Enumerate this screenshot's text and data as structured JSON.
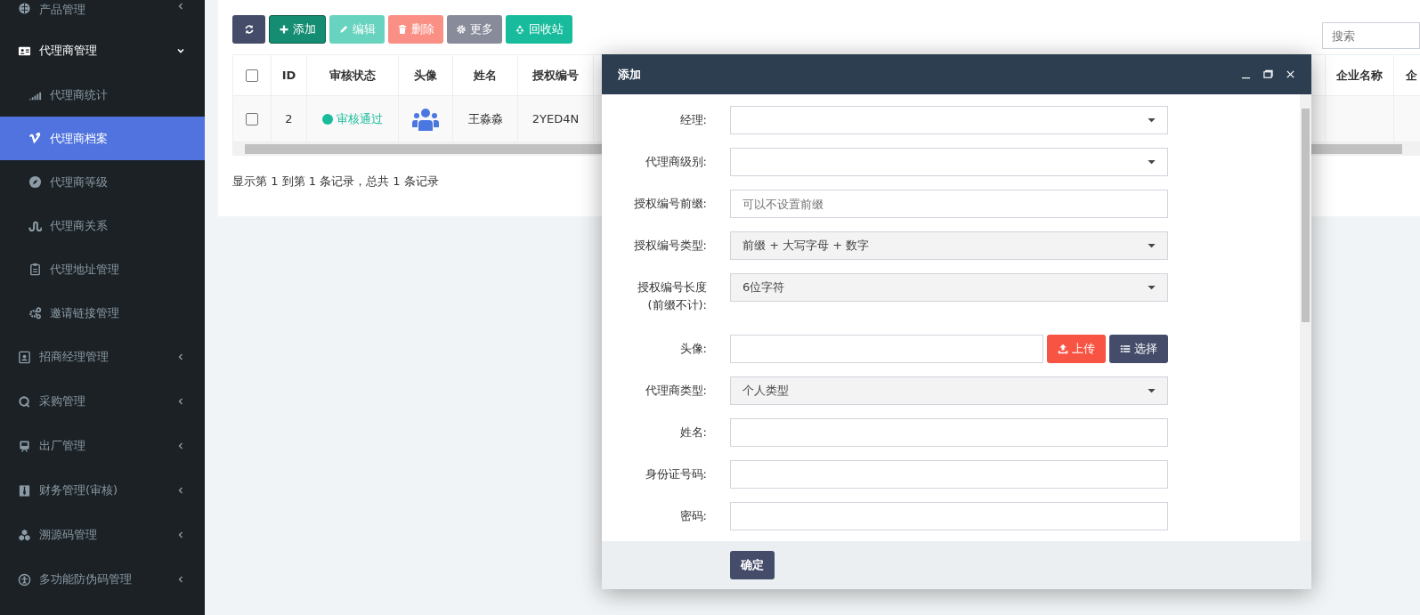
{
  "sidebar": {
    "items": [
      {
        "label": "产品管理",
        "selected": false,
        "expanded": false
      },
      {
        "label": "代理商管理",
        "selected": false,
        "expanded": true,
        "children": [
          {
            "label": "代理商统计",
            "selected": false
          },
          {
            "label": "代理商档案",
            "selected": true
          },
          {
            "label": "代理商等级",
            "selected": false
          },
          {
            "label": "代理商关系",
            "selected": false
          },
          {
            "label": "代理地址管理",
            "selected": false
          },
          {
            "label": "邀请链接管理",
            "selected": false
          }
        ]
      },
      {
        "label": "招商经理管理",
        "selected": false,
        "expanded": false
      },
      {
        "label": "采购管理",
        "selected": false,
        "expanded": false
      },
      {
        "label": "出厂管理",
        "selected": false,
        "expanded": false
      },
      {
        "label": "财务管理(审核)",
        "selected": false,
        "expanded": false
      },
      {
        "label": "溯源码管理",
        "selected": false,
        "expanded": false
      },
      {
        "label": "多功能防伪码管理",
        "selected": false,
        "expanded": false
      }
    ]
  },
  "toolbar": {
    "buttons": [
      {
        "kind": "refresh",
        "disabled": false
      },
      {
        "kind": "add",
        "label": "添加",
        "disabled": false
      },
      {
        "kind": "edit",
        "label": "编辑",
        "disabled": true
      },
      {
        "kind": "delete",
        "label": "删除",
        "disabled": true
      },
      {
        "kind": "more",
        "label": "更多",
        "disabled": false
      },
      {
        "kind": "recycle",
        "label": "回收站",
        "disabled": false
      }
    ],
    "search": {
      "placeholder": "搜索"
    }
  },
  "table": {
    "select_all": {
      "checked": false
    },
    "columns": [
      "ID",
      "审核状态",
      "头像",
      "姓名",
      "授权编号",
      "企业名称",
      "企"
    ],
    "rows": [
      {
        "checked": false,
        "id": "2",
        "status": {
          "label": "审核通过",
          "color": "#18bc9c"
        },
        "name": "王淼淼",
        "code": "2YED4N"
      }
    ]
  },
  "pagination": {
    "summary": "显示第 1 到第 1 条记录，总共 1 条记录"
  },
  "dialog": {
    "title": "添加",
    "fields": [
      {
        "kind": "select",
        "label": "经理:",
        "disabled": false
      },
      {
        "kind": "select",
        "label": "代理商级别:",
        "disabled": false
      },
      {
        "kind": "text",
        "label": "授权编号前缀:",
        "placeholder": "可以不设置前缀"
      },
      {
        "kind": "select",
        "label": "授权编号类型:",
        "value": "前缀 + 大写字母 + 数字",
        "disabled": true
      },
      {
        "kind": "select",
        "label": "授权编号长度",
        "note": "(前缀不计):",
        "value": "6位字符",
        "disabled": true
      },
      {
        "kind": "upload",
        "label": "头像:",
        "upload": "上传",
        "choose": "选择"
      },
      {
        "kind": "select",
        "label": "代理商类型:",
        "value": "个人类型",
        "disabled": true
      },
      {
        "kind": "text",
        "label": "姓名:"
      },
      {
        "kind": "text",
        "label": "身份证号码:"
      },
      {
        "kind": "text",
        "label": "密码:"
      }
    ],
    "confirm": "确定"
  }
}
